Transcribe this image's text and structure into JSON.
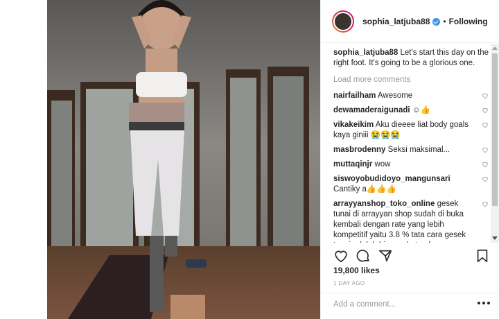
{
  "post": {
    "author": "sophia_latjuba88",
    "follow_status": "Following",
    "separator": "•",
    "caption": "Let's start this day on the right foot. It's going to be a glorious one.",
    "load_more": "Load more comments",
    "likes": "19,800 likes",
    "time": "1 DAY AGO",
    "add_comment_placeholder": "Add a comment..."
  },
  "comments": [
    {
      "user": "nairfailham",
      "text": "Awesome"
    },
    {
      "user": "dewamaderaigunadi",
      "text": "☺👍"
    },
    {
      "user": "vikakeikim",
      "text": "Aku dieeee liat body goals kaya giniii 😭😭😭"
    },
    {
      "user": "masbrodenny",
      "text": "Seksi maksimal..."
    },
    {
      "user": "muttaqinjr",
      "text": "wow"
    },
    {
      "user": "siswoyobudidoyo_mangunsari",
      "text": "Cantiky a👍👍👍"
    },
    {
      "user": "arrayyanshop_toko_online",
      "text": "gesek tunai di arrayyan shop sudah di buka kembali dengan rate yang lebih kompetitif yaitu 3.8 % tata cara gesek tunai adalah bisa cod atau langsung datang ke alamat arrayyan shop. untuk"
    }
  ],
  "icons": {
    "like": "heart-icon",
    "comment": "comment-icon",
    "share": "share-icon",
    "save": "bookmark-icon",
    "more": "more-options-icon"
  },
  "colors": {
    "verified": "#3897f0",
    "muted": "#999999",
    "text": "#262626",
    "border": "#efefef"
  }
}
